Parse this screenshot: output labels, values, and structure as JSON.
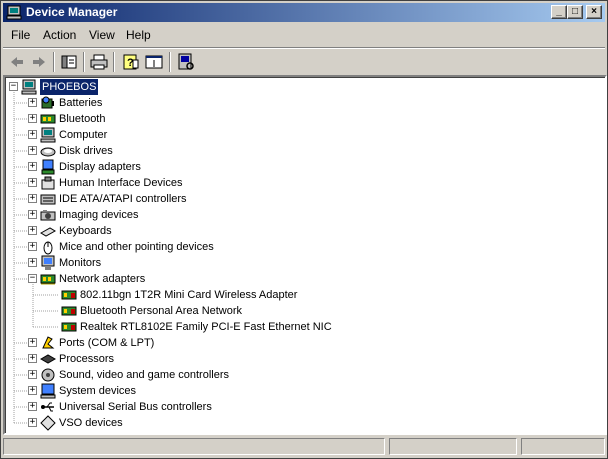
{
  "window": {
    "title": "Device Manager"
  },
  "caption_buttons": {
    "minimize": "_",
    "maximize": "□",
    "close": "×"
  },
  "menu": [
    "File",
    "Action",
    "View",
    "Help"
  ],
  "toolbar": [
    "back-icon",
    "forward-icon",
    "show-hide-tree-icon",
    "print-icon",
    "help-icon",
    "properties-icon",
    "scan-hardware-icon"
  ],
  "tree": {
    "root": {
      "label": "PHOEBOS",
      "icon": "computer-icon",
      "expanded": true
    },
    "items": [
      {
        "label": "Batteries",
        "icon": "battery-icon",
        "expanded": false
      },
      {
        "label": "Bluetooth",
        "icon": "bluetooth-icon",
        "expanded": false
      },
      {
        "label": "Computer",
        "icon": "computer-icon",
        "expanded": false
      },
      {
        "label": "Disk drives",
        "icon": "disk-drive-icon",
        "expanded": false
      },
      {
        "label": "Display adapters",
        "icon": "display-adapter-icon",
        "expanded": false
      },
      {
        "label": "Human Interface Devices",
        "icon": "hid-icon",
        "expanded": false
      },
      {
        "label": "IDE ATA/ATAPI controllers",
        "icon": "ide-controller-icon",
        "expanded": false
      },
      {
        "label": "Imaging devices",
        "icon": "imaging-device-icon",
        "expanded": false
      },
      {
        "label": "Keyboards",
        "icon": "keyboard-icon",
        "expanded": false
      },
      {
        "label": "Mice and other pointing devices",
        "icon": "mouse-icon",
        "expanded": false
      },
      {
        "label": "Monitors",
        "icon": "monitor-icon",
        "expanded": false
      },
      {
        "label": "Network adapters",
        "icon": "network-adapter-icon",
        "expanded": true,
        "children": [
          {
            "label": "802.11bgn 1T2R Mini Card Wireless Adapter",
            "icon": "network-card-icon"
          },
          {
            "label": "Bluetooth Personal Area Network",
            "icon": "network-card-icon"
          },
          {
            "label": "Realtek RTL8102E Family PCI-E Fast Ethernet NIC",
            "icon": "network-card-icon"
          }
        ]
      },
      {
        "label": "Ports (COM & LPT)",
        "icon": "port-icon",
        "expanded": false
      },
      {
        "label": "Processors",
        "icon": "processor-icon",
        "expanded": false
      },
      {
        "label": "Sound, video and game controllers",
        "icon": "sound-icon",
        "expanded": false
      },
      {
        "label": "System devices",
        "icon": "system-device-icon",
        "expanded": false
      },
      {
        "label": "Universal Serial Bus controllers",
        "icon": "usb-icon",
        "expanded": false
      },
      {
        "label": "VSO devices",
        "icon": "vso-device-icon",
        "expanded": false
      }
    ]
  },
  "colors": {
    "selection": "#0a246a",
    "titlebar_start": "#0a246a",
    "titlebar_end": "#a6caf0",
    "chrome": "#d4d0c8"
  }
}
